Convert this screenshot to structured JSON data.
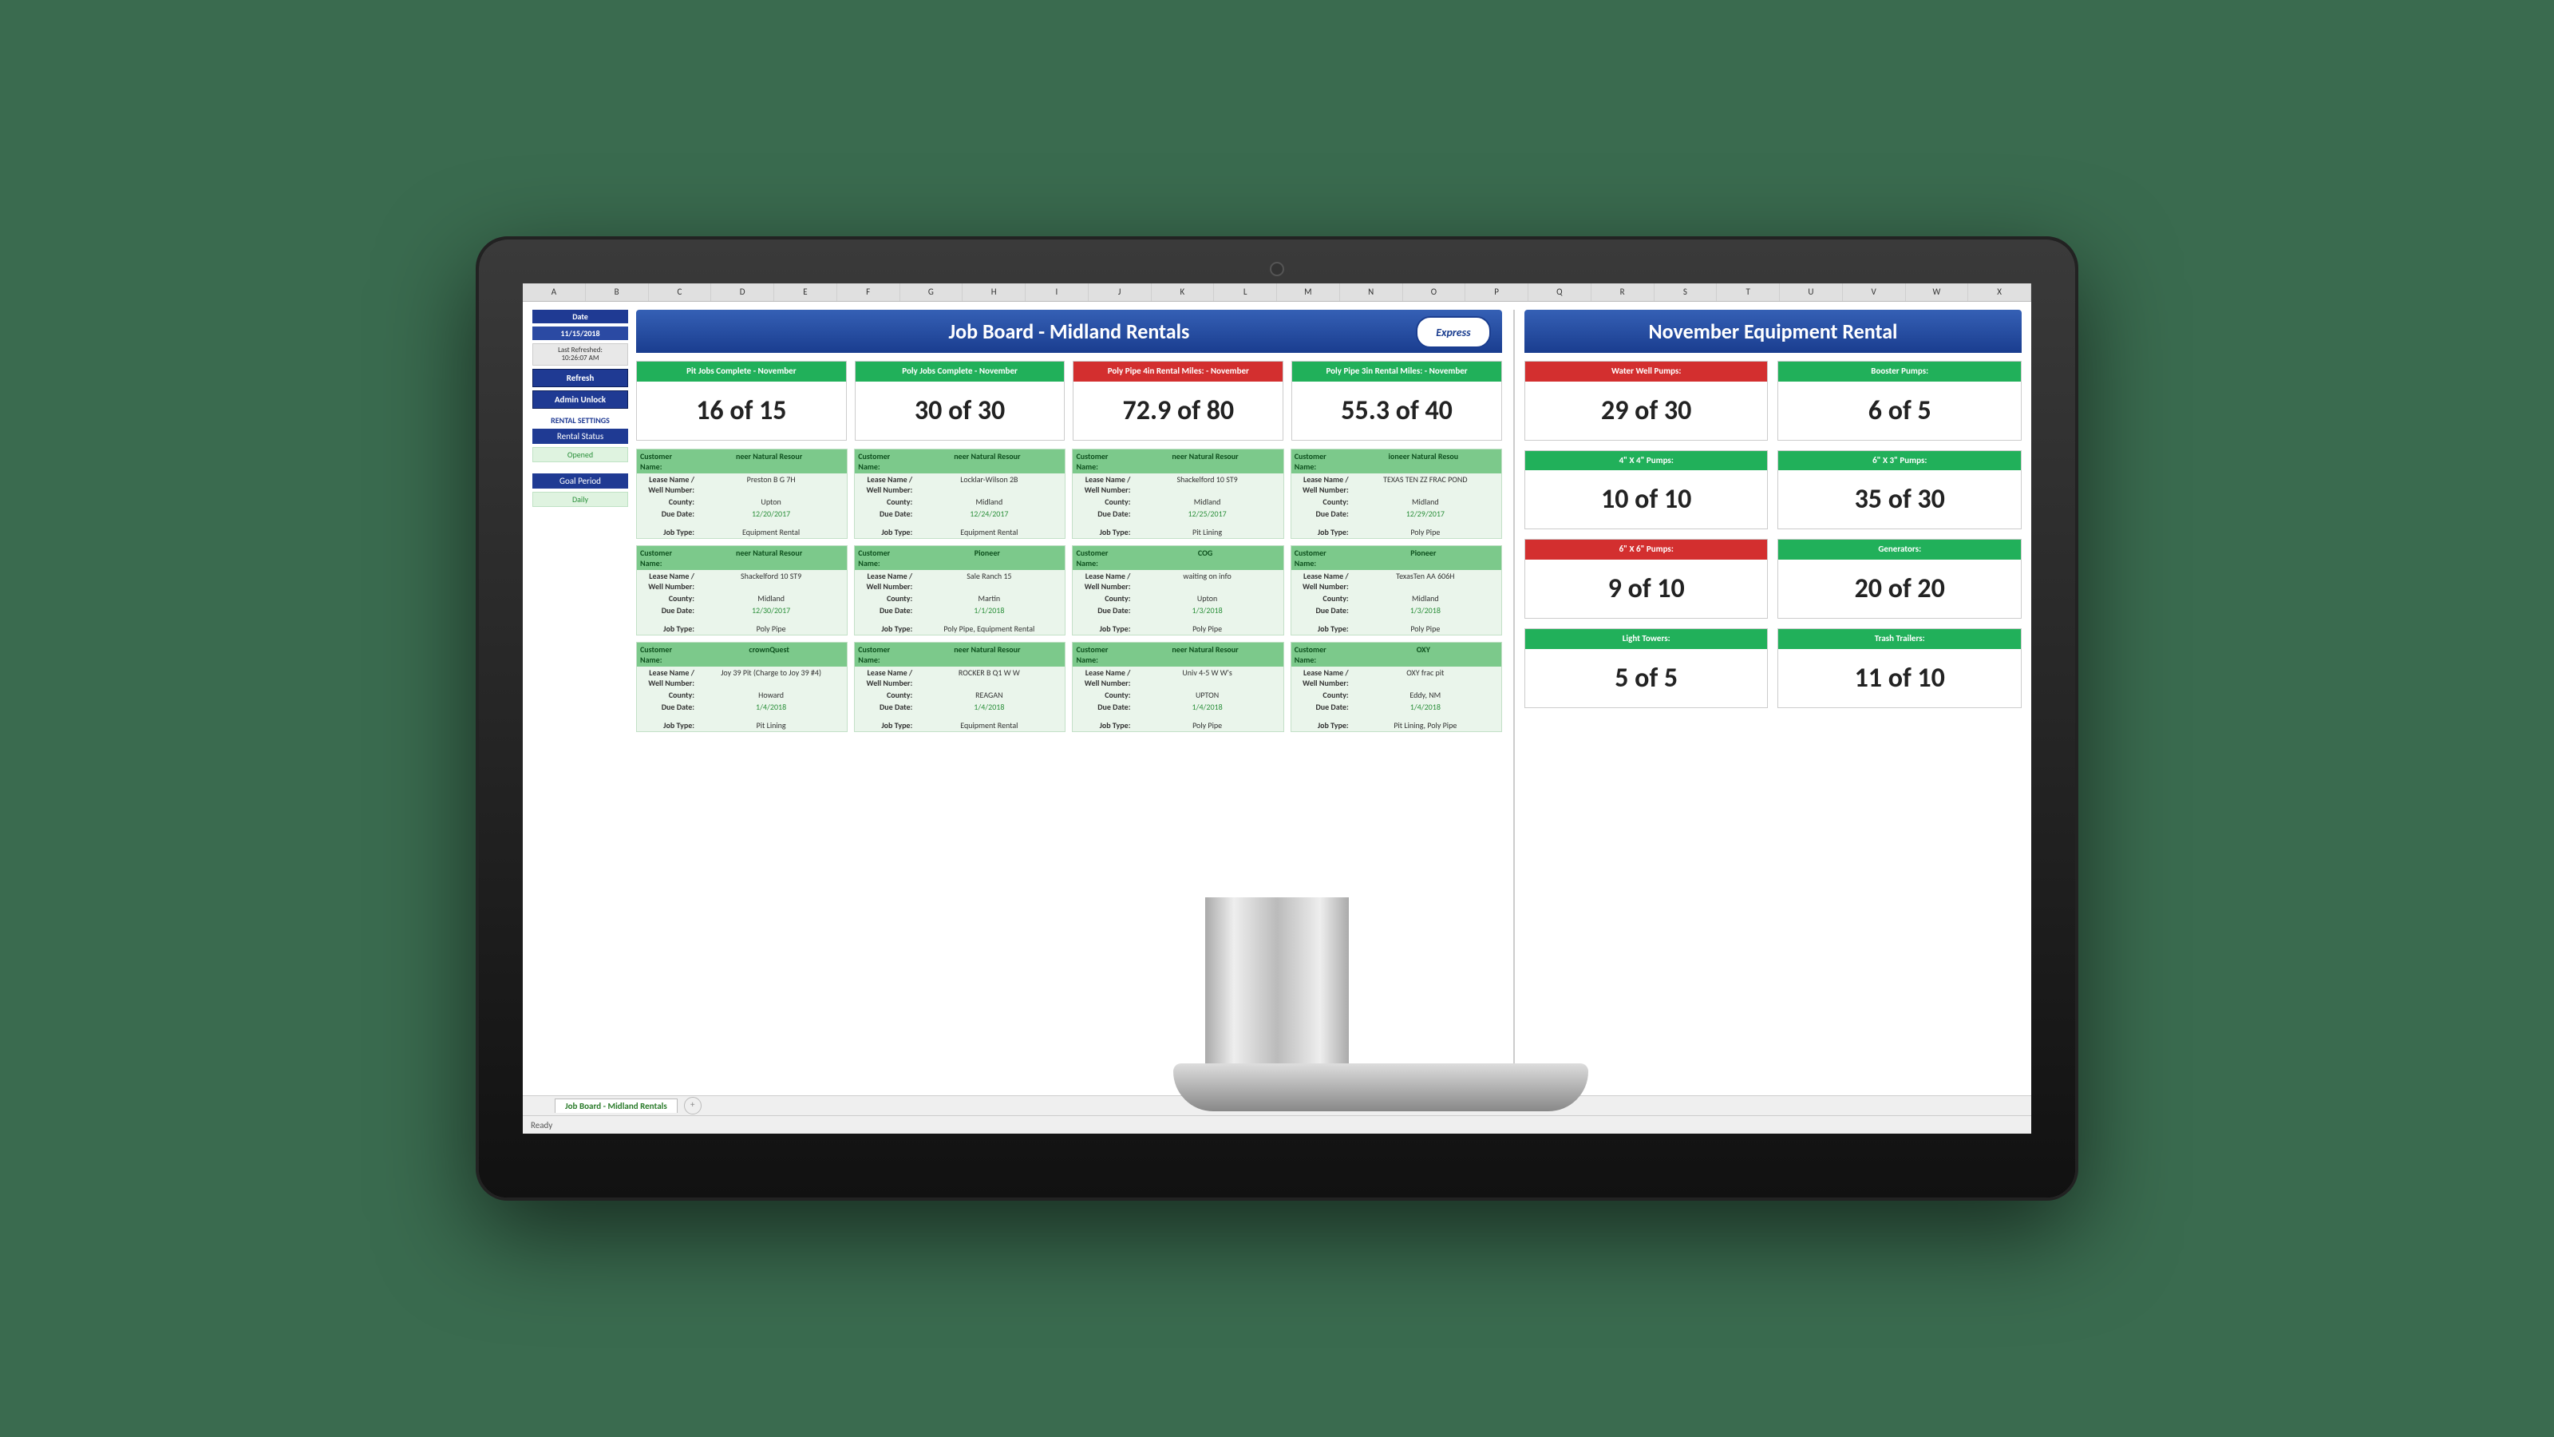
{
  "ruler_cols": [
    "A",
    "B",
    "C",
    "D",
    "E",
    "F",
    "G",
    "H",
    "I",
    "J",
    "K",
    "L",
    "M",
    "N",
    "O",
    "P",
    "Q",
    "R",
    "S",
    "T",
    "U",
    "V",
    "W",
    "X"
  ],
  "header": {
    "left_title": "Job Board - Midland Rentals",
    "logo": "Express",
    "right_title": "November Equipment Rental"
  },
  "side": {
    "date_label": "Date",
    "date_value": "11/15/2018",
    "refresh_label": "Last Refreshed:",
    "refresh_value": "10:26:07 AM",
    "btn_refresh": "Refresh",
    "btn_unlock": "Admin Unlock",
    "settings_caption": "RENTAL SETTINGS",
    "rental_status_label": "Rental Status",
    "rental_status_value": "Opened",
    "goal_label": "Goal Period",
    "goal_value": "Daily"
  },
  "metrics": [
    {
      "title": "Pit Jobs Complete - November",
      "value": "16 of 15",
      "color": "green"
    },
    {
      "title": "Poly Jobs Complete - November",
      "value": "30 of 30",
      "color": "green"
    },
    {
      "title": "Poly Pipe 4in Rental Miles: - November",
      "value": "72.9 of 80",
      "color": "red"
    },
    {
      "title": "Poly Pipe 3in Rental Miles: - November",
      "value": "55.3 of 40",
      "color": "green"
    }
  ],
  "rentals": [
    {
      "title": "Water Well Pumps:",
      "value": "29 of 30",
      "color": "red"
    },
    {
      "title": "Booster Pumps:",
      "value": "6 of 5",
      "color": "green"
    },
    {
      "title": "4\" X 4\" Pumps:",
      "value": "10 of 10",
      "color": "green"
    },
    {
      "title": "6\" X 3\" Pumps:",
      "value": "35 of 30",
      "color": "green"
    },
    {
      "title": "6\" X 6\" Pumps:",
      "value": "9 of 10",
      "color": "red"
    },
    {
      "title": "Generators:",
      "value": "20 of 20",
      "color": "green"
    },
    {
      "title": "Light Towers:",
      "value": "5 of 5",
      "color": "green"
    },
    {
      "title": "Trash Trailers:",
      "value": "11 of 10",
      "color": "green"
    }
  ],
  "job_labels": {
    "cust": "Customer Name:",
    "lease": "Lease Name / Well Number:",
    "county": "County:",
    "due": "Due Date:",
    "type": "Job Type:"
  },
  "jobs": [
    {
      "cust": "neer Natural Resour",
      "lease": "Preston B G 7H",
      "county": "Upton",
      "due": "12/20/2017",
      "type": "Equipment Rental"
    },
    {
      "cust": "neer Natural Resour",
      "lease": "Locklar-Wilson 2B",
      "county": "Midland",
      "due": "12/24/2017",
      "type": "Equipment Rental"
    },
    {
      "cust": "neer Natural Resour",
      "lease": "Shackelford 10 ST9",
      "county": "Midland",
      "due": "12/25/2017",
      "type": "Pit Lining"
    },
    {
      "cust": "ioneer Natural Resou",
      "lease": "TEXAS TEN ZZ FRAC POND",
      "county": "Midland",
      "due": "12/29/2017",
      "type": "Poly Pipe"
    },
    {
      "cust": "neer Natural Resour",
      "lease": "Shackelford 10 ST9",
      "county": "Midland",
      "due": "12/30/2017",
      "type": "Poly Pipe"
    },
    {
      "cust": "Pioneer",
      "lease": "Sale Ranch 15",
      "county": "Martin",
      "due": "1/1/2018",
      "type": "Poly Pipe, Equipment Rental"
    },
    {
      "cust": "COG",
      "lease": "waiting on info",
      "county": "Upton",
      "due": "1/3/2018",
      "type": "Poly Pipe"
    },
    {
      "cust": "Pioneer",
      "lease": "TexasTen AA 606H",
      "county": "Midland",
      "due": "1/3/2018",
      "type": "Poly Pipe"
    },
    {
      "cust": "crownQuest",
      "lease": "Joy 39 Pit (Charge to Joy 39 #4)",
      "county": "Howard",
      "due": "1/4/2018",
      "type": "Pit Lining"
    },
    {
      "cust": "neer Natural Resour",
      "lease": "ROCKER B Q1 W W",
      "county": "REAGAN",
      "due": "1/4/2018",
      "type": "Equipment Rental"
    },
    {
      "cust": "neer Natural Resour",
      "lease": "Univ 4-5 W W's",
      "county": "UPTON",
      "due": "1/4/2018",
      "type": "Poly Pipe"
    },
    {
      "cust": "OXY",
      "lease": "OXY frac pit",
      "county": "Eddy, NM",
      "due": "1/4/2018",
      "type": "Pit Lining, Poly Pipe"
    }
  ],
  "tab": {
    "name": "Job Board - Midland Rentals",
    "plus": "+"
  },
  "status": {
    "ready": "Ready"
  }
}
